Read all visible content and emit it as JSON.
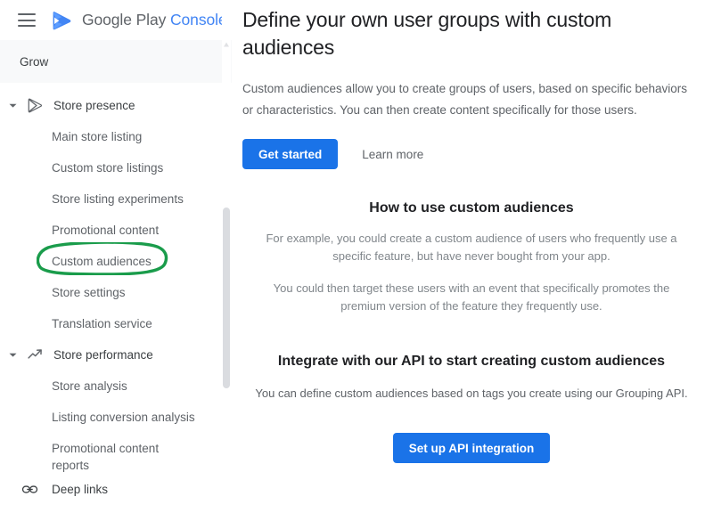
{
  "brand": {
    "menu_icon": "hamburger-menu-icon",
    "logo_icon": "google-play-logo-icon",
    "name_part1": "Google Play",
    "name_part2": "Console"
  },
  "sidebar": {
    "section_header": "Grow",
    "groups": [
      {
        "label": "Store presence",
        "icon": "google-play-outline-icon",
        "expanded": true,
        "items": [
          {
            "label": "Main store listing",
            "highlighted": false
          },
          {
            "label": "Custom store listings",
            "highlighted": false
          },
          {
            "label": "Store listing experiments",
            "highlighted": false
          },
          {
            "label": "Promotional content",
            "highlighted": false
          },
          {
            "label": "Custom audiences",
            "highlighted": true
          },
          {
            "label": "Store settings",
            "highlighted": false
          },
          {
            "label": "Translation service",
            "highlighted": false
          }
        ]
      },
      {
        "label": "Store performance",
        "icon": "trending-up-icon",
        "expanded": true,
        "items": [
          {
            "label": "Store analysis",
            "highlighted": false
          },
          {
            "label": "Listing conversion analysis",
            "highlighted": false
          },
          {
            "label": "Promotional content reports",
            "highlighted": false
          }
        ]
      }
    ],
    "standalone": [
      {
        "label": "Deep links",
        "icon": "link-chain-icon"
      }
    ],
    "highlight_color": "#1a9c4b",
    "scrollbar": {
      "thumb_color": "#dadce0"
    }
  },
  "main": {
    "title": "Define your own user groups with custom audiences",
    "description": "Custom audiences allow you to create groups of users, based on specific behaviors or characteristics. You can then create content specifically for those users.",
    "primary_button": "Get started",
    "secondary_link": "Learn more",
    "how_to": {
      "title": "How to use custom audiences",
      "paragraph1": "For example, you could create a custom audience of users who frequently use a specific feature, but have never bought from your app.",
      "paragraph2": "You could then target these users with an event that specifically promotes the premium version of the feature they frequently use."
    },
    "api": {
      "title": "Integrate with our API to start creating custom audiences",
      "paragraph": "You can define custom audiences based on tags you create using our Grouping API.",
      "button": "Set up API integration"
    },
    "accent_color": "#1a73e8"
  }
}
